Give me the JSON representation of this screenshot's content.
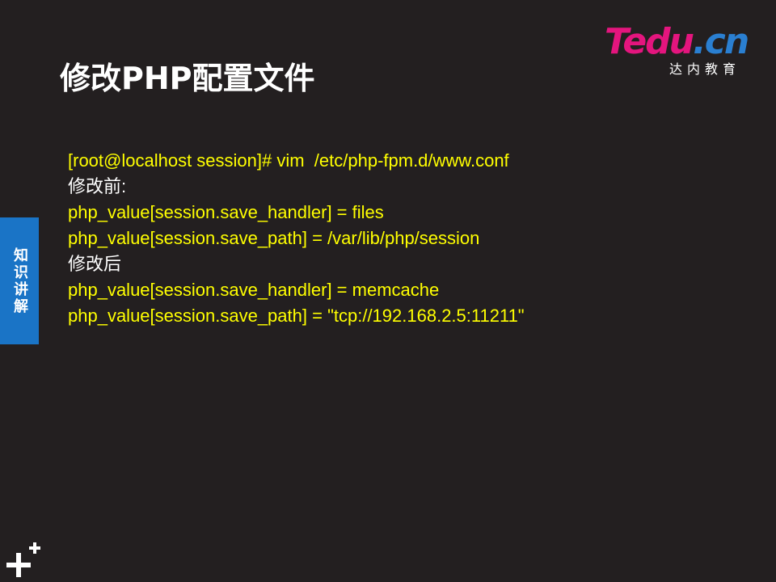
{
  "slide": {
    "title": "修改PHP配置文件",
    "side_tab_label": "知识讲解"
  },
  "logo": {
    "brand": "Tedu",
    "tld": ".cn",
    "subtitle": "达内教育"
  },
  "content": {
    "lines": [
      {
        "text": "[root@localhost session]# vim  /etc/php-fpm.d/www.conf",
        "kind": "code"
      },
      {
        "text": "修改前:",
        "kind": "label"
      },
      {
        "text": "php_value[session.save_handler] = files",
        "kind": "code"
      },
      {
        "text": "php_value[session.save_path] = /var/lib/php/session",
        "kind": "code"
      },
      {
        "text": "修改后",
        "kind": "label"
      },
      {
        "text": "php_value[session.save_handler] = memcache",
        "kind": "code"
      },
      {
        "text": "php_value[session.save_path] = \"tcp://192.168.2.5:11211\"",
        "kind": "code"
      }
    ]
  },
  "colors": {
    "background": "#231f20",
    "code_text": "#ffff00",
    "label_text": "#ffffff",
    "side_tab": "#1a74c6",
    "logo_brand": "#e4157e",
    "logo_tld": "#2a7fd1"
  },
  "icons": {
    "corner": "plus-icon"
  }
}
